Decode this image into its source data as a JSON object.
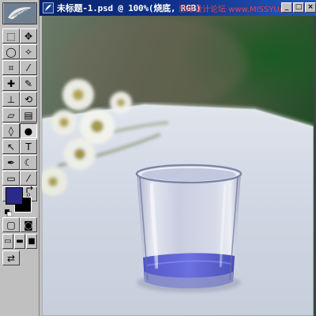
{
  "window": {
    "title": "未标题-1.psd @ 100%(烧底, RGB)",
    "watermark": "思缘设计论坛 www.MISSYUAN.com",
    "controls": {
      "minimize": "_",
      "maximize": "□",
      "close": "×"
    }
  },
  "toolbox": {
    "tools": [
      {
        "name": "marquee-tool",
        "icon": "dashed-rect-icon",
        "glyph": "⬚"
      },
      {
        "name": "move-tool",
        "icon": "move-arrow-icon",
        "glyph": "✥"
      },
      {
        "name": "lasso-tool",
        "icon": "lasso-icon",
        "glyph": "◯"
      },
      {
        "name": "magic-wand-tool",
        "icon": "magic-wand-icon",
        "glyph": "✧"
      },
      {
        "name": "crop-tool",
        "icon": "crop-icon",
        "glyph": "⌗"
      },
      {
        "name": "slice-tool",
        "icon": "slice-knife-icon",
        "glyph": "⁄"
      },
      {
        "name": "healing-brush-tool",
        "icon": "bandage-icon",
        "glyph": "✚"
      },
      {
        "name": "brush-tool",
        "icon": "paintbrush-icon",
        "glyph": "✎"
      },
      {
        "name": "clone-stamp-tool",
        "icon": "stamp-icon",
        "glyph": "⊥"
      },
      {
        "name": "history-brush-tool",
        "icon": "history-brush-icon",
        "glyph": "⟲"
      },
      {
        "name": "eraser-tool",
        "icon": "eraser-icon",
        "glyph": "▱"
      },
      {
        "name": "gradient-tool",
        "icon": "gradient-icon",
        "glyph": "▤"
      },
      {
        "name": "blur-tool",
        "icon": "water-drop-icon",
        "glyph": "◊"
      },
      {
        "name": "dodge-tool",
        "icon": "dodge-circle-icon",
        "glyph": "●"
      },
      {
        "name": "path-selection-tool",
        "icon": "arrow-cursor-icon",
        "glyph": "↖"
      },
      {
        "name": "type-tool",
        "icon": "type-t-icon",
        "glyph": "T"
      },
      {
        "name": "pen-tool",
        "icon": "pen-nib-icon",
        "glyph": "✒"
      },
      {
        "name": "shape-tool",
        "icon": "custom-shape-icon",
        "glyph": "☾"
      },
      {
        "name": "notes-tool",
        "icon": "note-icon",
        "glyph": "▭"
      },
      {
        "name": "eyedropper-tool",
        "icon": "eyedropper-icon",
        "glyph": "⁄"
      },
      {
        "name": "hand-tool",
        "icon": "hand-icon",
        "glyph": "✋"
      },
      {
        "name": "zoom-tool",
        "icon": "magnifier-icon",
        "glyph": "⌕"
      }
    ],
    "modes": [
      {
        "name": "standard-mode-button",
        "icon": "standard-mode-icon",
        "glyph": "▢"
      },
      {
        "name": "quick-mask-button",
        "icon": "quick-mask-icon",
        "glyph": "◙"
      }
    ],
    "screen_modes": [
      {
        "name": "screen-mode-standard",
        "icon": "screen-window-icon",
        "glyph": "▭"
      },
      {
        "name": "screen-mode-full-menu",
        "icon": "screen-full-menu-icon",
        "glyph": "▬"
      },
      {
        "name": "screen-mode-full",
        "icon": "screen-full-icon",
        "glyph": "■"
      }
    ],
    "jump": {
      "name": "jump-to-imageready-button",
      "icon": "imageready-jump-icon",
      "glyph": "⇄"
    },
    "colors": {
      "foreground": "#2a2a8a",
      "background": "#000000"
    }
  }
}
